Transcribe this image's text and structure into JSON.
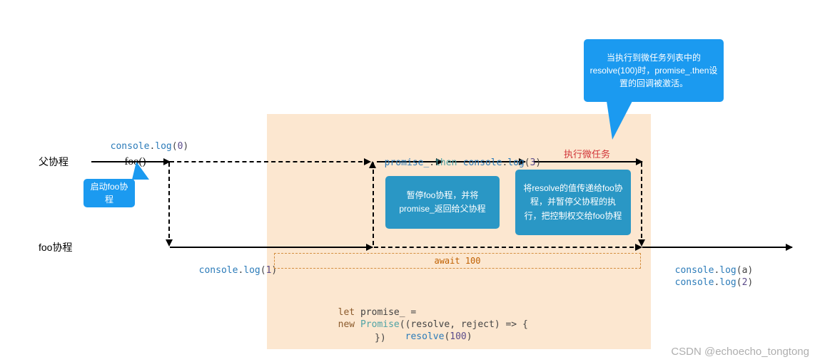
{
  "rows": {
    "parent": "父协程",
    "foo": "foo协程"
  },
  "labels": {
    "log0": "console.log(0)",
    "foo_call": "foo()",
    "promise_then": "promise_.then",
    "log3": "console.log(3)",
    "exec_micro": "执行微任务",
    "log1": "console.log(1)",
    "await_100": "await 100",
    "log_a": "console.log(a)",
    "log_2": "console.log(2)"
  },
  "code": {
    "let_line": "let promise_ =",
    "new_line_prefix": "new ",
    "promise_word": "Promise",
    "args_open": "((resolve, reject) => {",
    "resolve_line": "resolve(100)",
    "close": "})"
  },
  "callouts": {
    "top_right": "当执行到微任务列表中的resolve(100)时，promise_.then设置的回调被激活。",
    "start_foo": "启动foo协程",
    "pause_foo": "暂停foo协程，并将promise_返回给父协程",
    "pass_resolve": "将resolve的值传递给foo协程，并暂停父协程的执行，把控制权交给foo协程"
  },
  "watermark": "CSDN @echoecho_tongtong"
}
